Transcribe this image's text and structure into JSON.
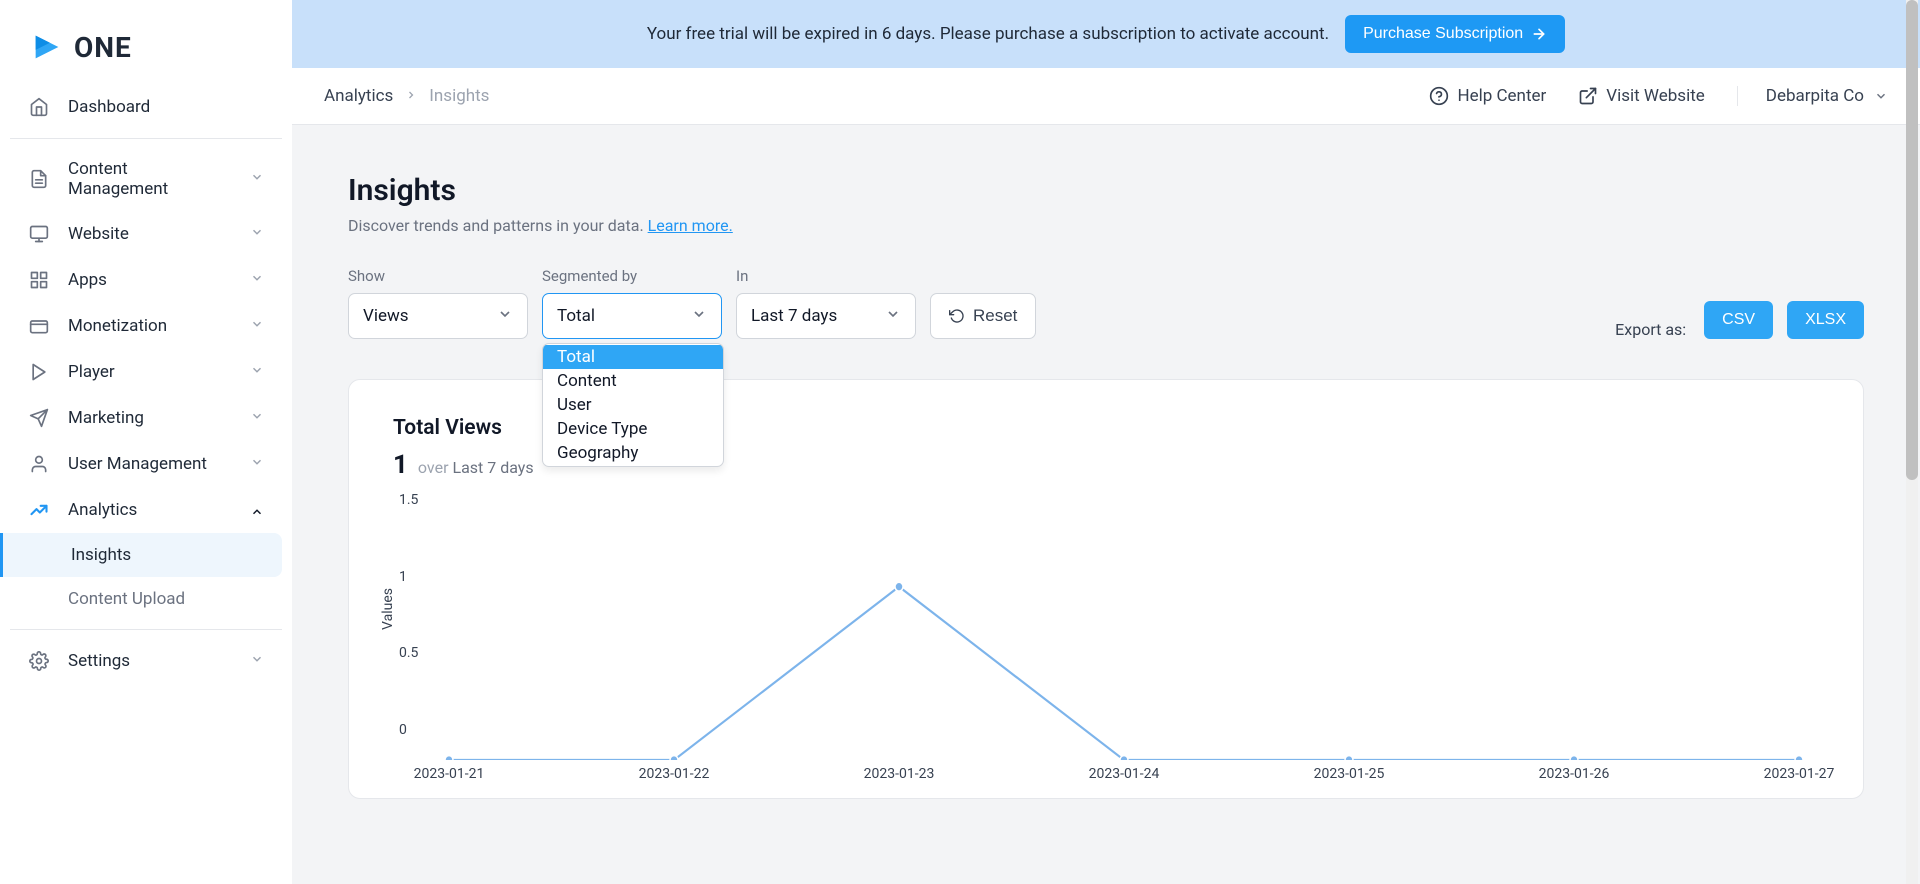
{
  "brand": {
    "name": "ONE"
  },
  "sidebar": {
    "dashboard": "Dashboard",
    "items": [
      {
        "label": "Content Management"
      },
      {
        "label": "Website"
      },
      {
        "label": "Apps"
      },
      {
        "label": "Monetization"
      },
      {
        "label": "Player"
      },
      {
        "label": "Marketing"
      },
      {
        "label": "User Management"
      },
      {
        "label": "Analytics"
      }
    ],
    "analytics_sub": [
      {
        "label": "Insights",
        "active": true
      },
      {
        "label": "Content Upload",
        "active": false
      }
    ],
    "settings": "Settings"
  },
  "banner": {
    "text": "Your free trial will be expired in 6 days. Please purchase a subscription to activate account.",
    "button": "Purchase Subscription"
  },
  "breadcrumb": {
    "root": "Analytics",
    "current": "Insights"
  },
  "topbar": {
    "help": "Help Center",
    "visit": "Visit Website",
    "account": "Debarpita Co"
  },
  "page": {
    "title": "Insights",
    "subtitle": "Discover trends and patterns in your data. ",
    "learn_more": "Learn more."
  },
  "controls": {
    "show_label": "Show",
    "show_value": "Views",
    "segmented_label": "Segmented by",
    "segmented_value": "Total",
    "segmented_options": [
      "Total",
      "Content",
      "User",
      "Device Type",
      "Geography"
    ],
    "in_label": "In",
    "in_value": "Last 7 days",
    "reset": "Reset",
    "export_label": "Export as:",
    "export_csv": "CSV",
    "export_xlsx": "XLSX"
  },
  "chart_card": {
    "title": "Total Views",
    "value": "1",
    "over": "over",
    "range": "Last 7 days",
    "ylabel": "Values"
  },
  "chart_data": {
    "type": "line",
    "title": "Total Views",
    "xlabel": "",
    "ylabel": "Values",
    "ylim": [
      0,
      1.5
    ],
    "y_ticks": [
      0,
      0.5,
      1,
      1.5
    ],
    "categories": [
      "2023-01-21",
      "2023-01-22",
      "2023-01-23",
      "2023-01-24",
      "2023-01-25",
      "2023-01-26",
      "2023-01-27"
    ],
    "values": [
      0,
      0,
      1,
      0,
      0,
      0,
      0
    ]
  }
}
